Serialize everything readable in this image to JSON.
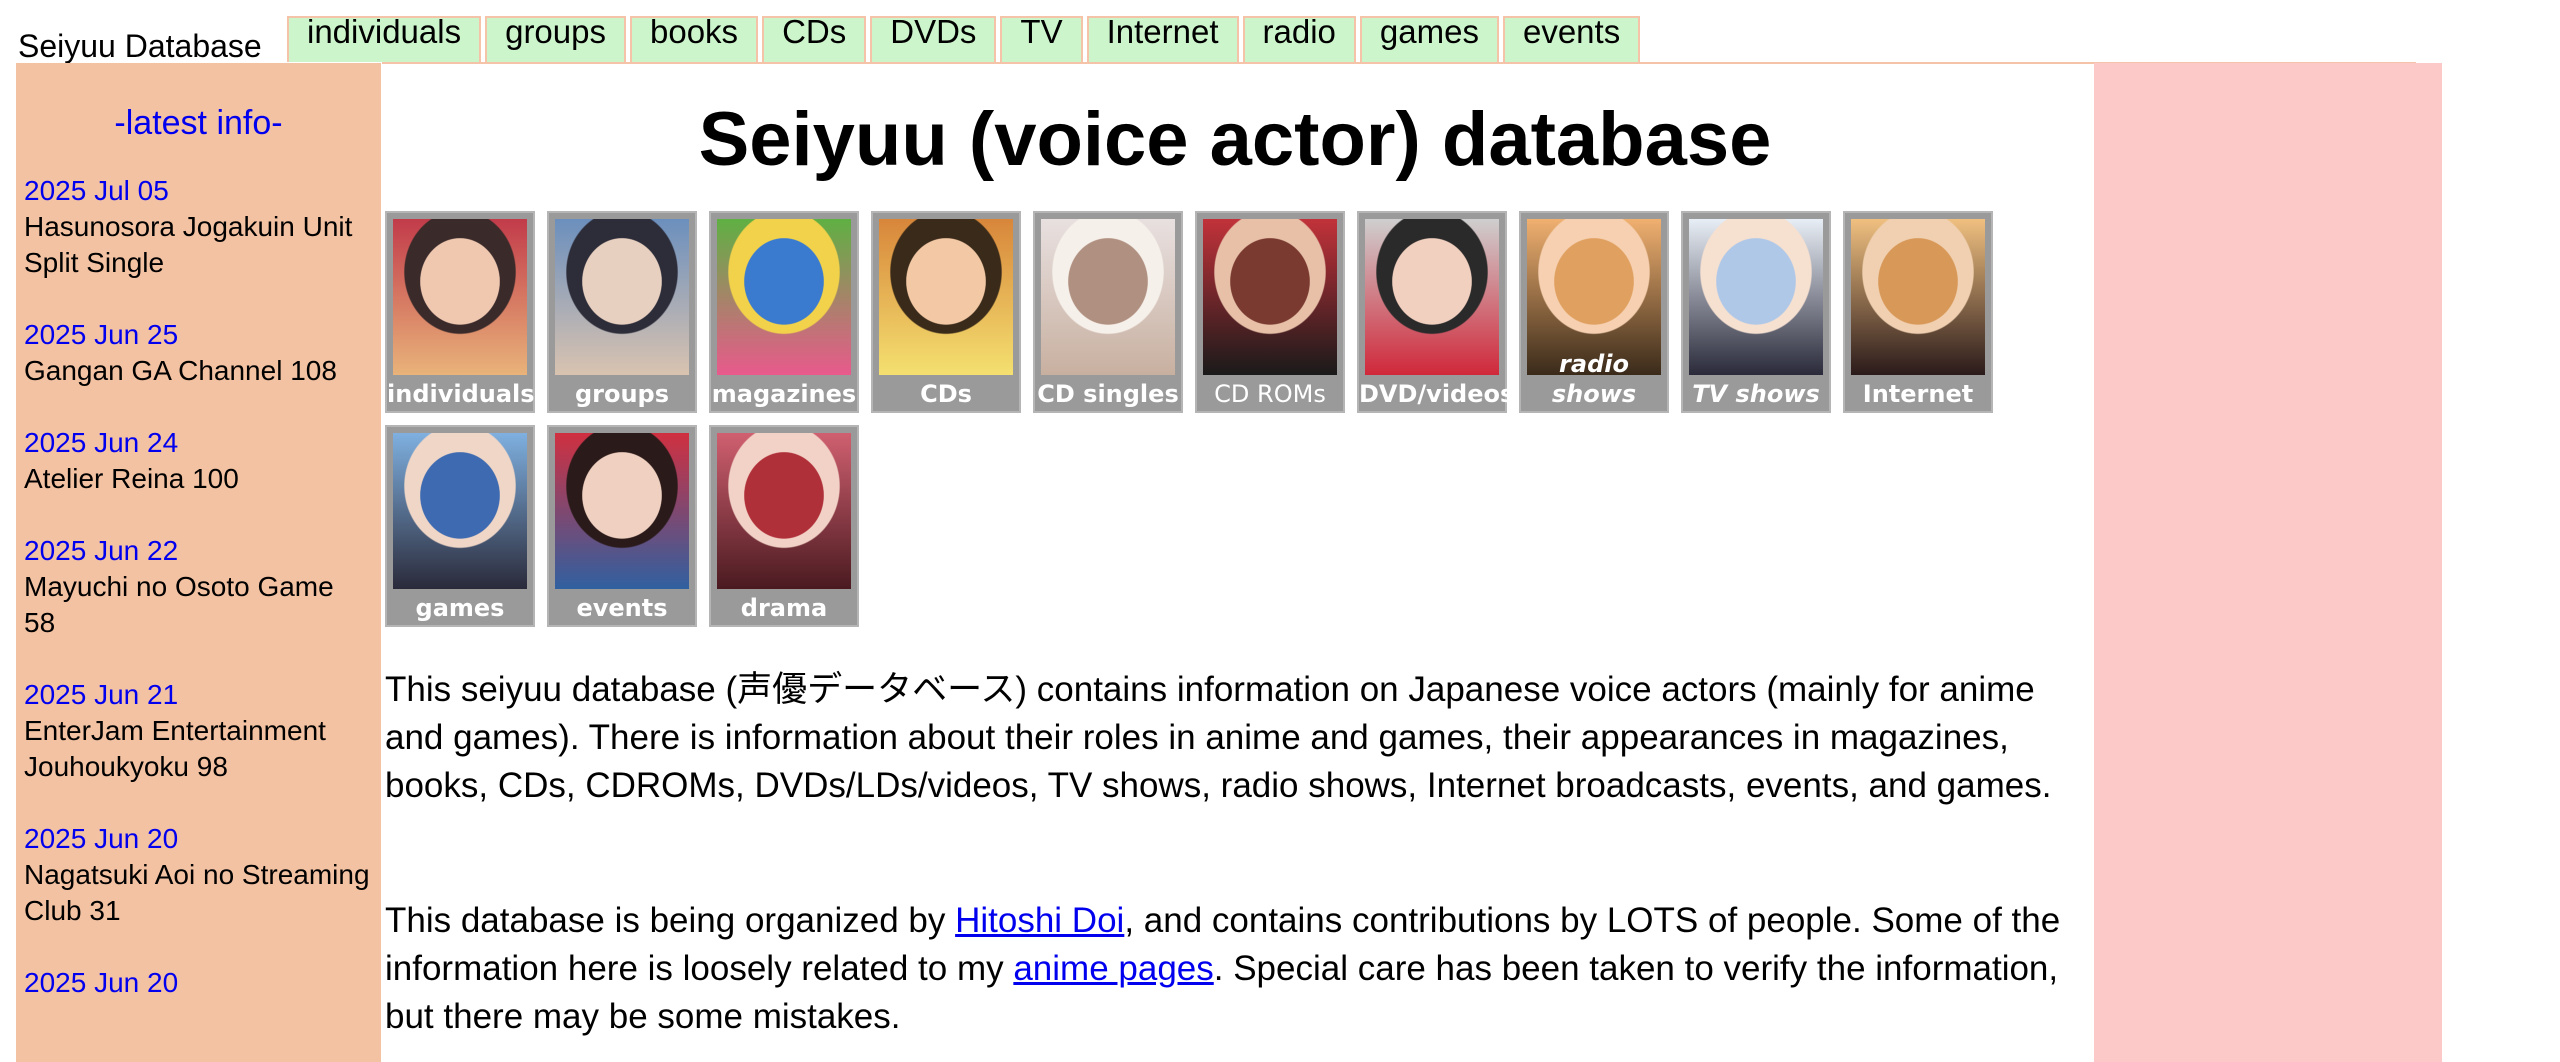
{
  "site_name": "Seiyuu Database",
  "nav_tabs": [
    "individuals",
    "groups",
    "books",
    "CDs",
    "DVDs",
    "TV",
    "Internet",
    "radio",
    "games",
    "events"
  ],
  "sidebar": {
    "title": "-latest info-",
    "items": [
      {
        "date": "2025 Jul 05",
        "text": "Hasunosora Jogakuin Unit Split Single"
      },
      {
        "date": "2025 Jun 25",
        "text": "Gangan GA Channel 108"
      },
      {
        "date": "2025 Jun 24",
        "text": "Atelier Reina 100"
      },
      {
        "date": "2025 Jun 22",
        "text": "Mayuchi no Osoto Game 58"
      },
      {
        "date": "2025 Jun 21",
        "text": "EnterJam Entertainment Jouhoukyoku 98"
      },
      {
        "date": "2025 Jun 20",
        "text": "Nagatsuki Aoi no Streaming Club 31"
      },
      {
        "date": "2025 Jun 20",
        "text": ""
      }
    ]
  },
  "main": {
    "title": "Seiyuu (voice actor) database",
    "tiles": [
      {
        "caption": "individuals",
        "colors": [
          "#c23b4a",
          "#e9b37a",
          "#3a2a2a",
          "#f0c8b0"
        ]
      },
      {
        "caption": "groups",
        "colors": [
          "#6b8fbd",
          "#d9c3b0",
          "#2d2d3a",
          "#e8d0c0"
        ]
      },
      {
        "caption": "magazines",
        "colors": [
          "#5fb043",
          "#e85a8c",
          "#f2d24a",
          "#3a7bd0"
        ]
      },
      {
        "caption": "CDs",
        "colors": [
          "#d8863a",
          "#f4e070",
          "#3a2a1a",
          "#f3c9a5"
        ]
      },
      {
        "caption": "CD singles",
        "colors": [
          "#e8e0e0",
          "#c8b0a0",
          "#f6f0ea",
          "#b09080"
        ]
      },
      {
        "caption": "CD ROMs",
        "colors": [
          "#c2323a",
          "#1a1a1a",
          "#e8c0a8",
          "#7a3a30"
        ]
      },
      {
        "caption": "DVD/videos",
        "colors": [
          "#cfcfcf",
          "#d0283a",
          "#2a2a2a",
          "#f2d0c0"
        ]
      },
      {
        "caption": "radio shows",
        "colors": [
          "#f0b070",
          "#3a2a1a",
          "#f6d0b0",
          "#e0a060"
        ]
      },
      {
        "caption": "TV shows",
        "colors": [
          "#e8eef6",
          "#2a2a3a",
          "#f6e0d0",
          "#b0c8e8"
        ]
      },
      {
        "caption": "Internet",
        "colors": [
          "#f0c080",
          "#2a1a1a",
          "#f0d0b0",
          "#d89858"
        ]
      },
      {
        "caption": "games",
        "colors": [
          "#7fb0e0",
          "#2a2a3a",
          "#f0d6c6",
          "#3d6ab0"
        ]
      },
      {
        "caption": "events",
        "colors": [
          "#d03040",
          "#3060a0",
          "#2a1a1a",
          "#f0d0c0"
        ]
      },
      {
        "caption": "drama",
        "colors": [
          "#d06070",
          "#4a1a20",
          "#f2d2c6",
          "#b0303a"
        ]
      }
    ],
    "para1": "This seiyuu database (声優データベース) contains information on Japanese voice actors (mainly for anime and games). There is information about their roles in anime and games, their appearances in magazines, books, CDs, CDROMs, DVDs/LDs/videos, TV shows, radio shows, Internet broadcasts, events, and games.",
    "para2": {
      "before": "This database is being organized by ",
      "link1": "Hitoshi Doi",
      "middle": ", and contains contributions by LOTS of people. Some of the information here is loosely related to my ",
      "link2": "anime pages",
      "after": ". Special care has been taken to verify the information, but there may be some mistakes."
    }
  }
}
